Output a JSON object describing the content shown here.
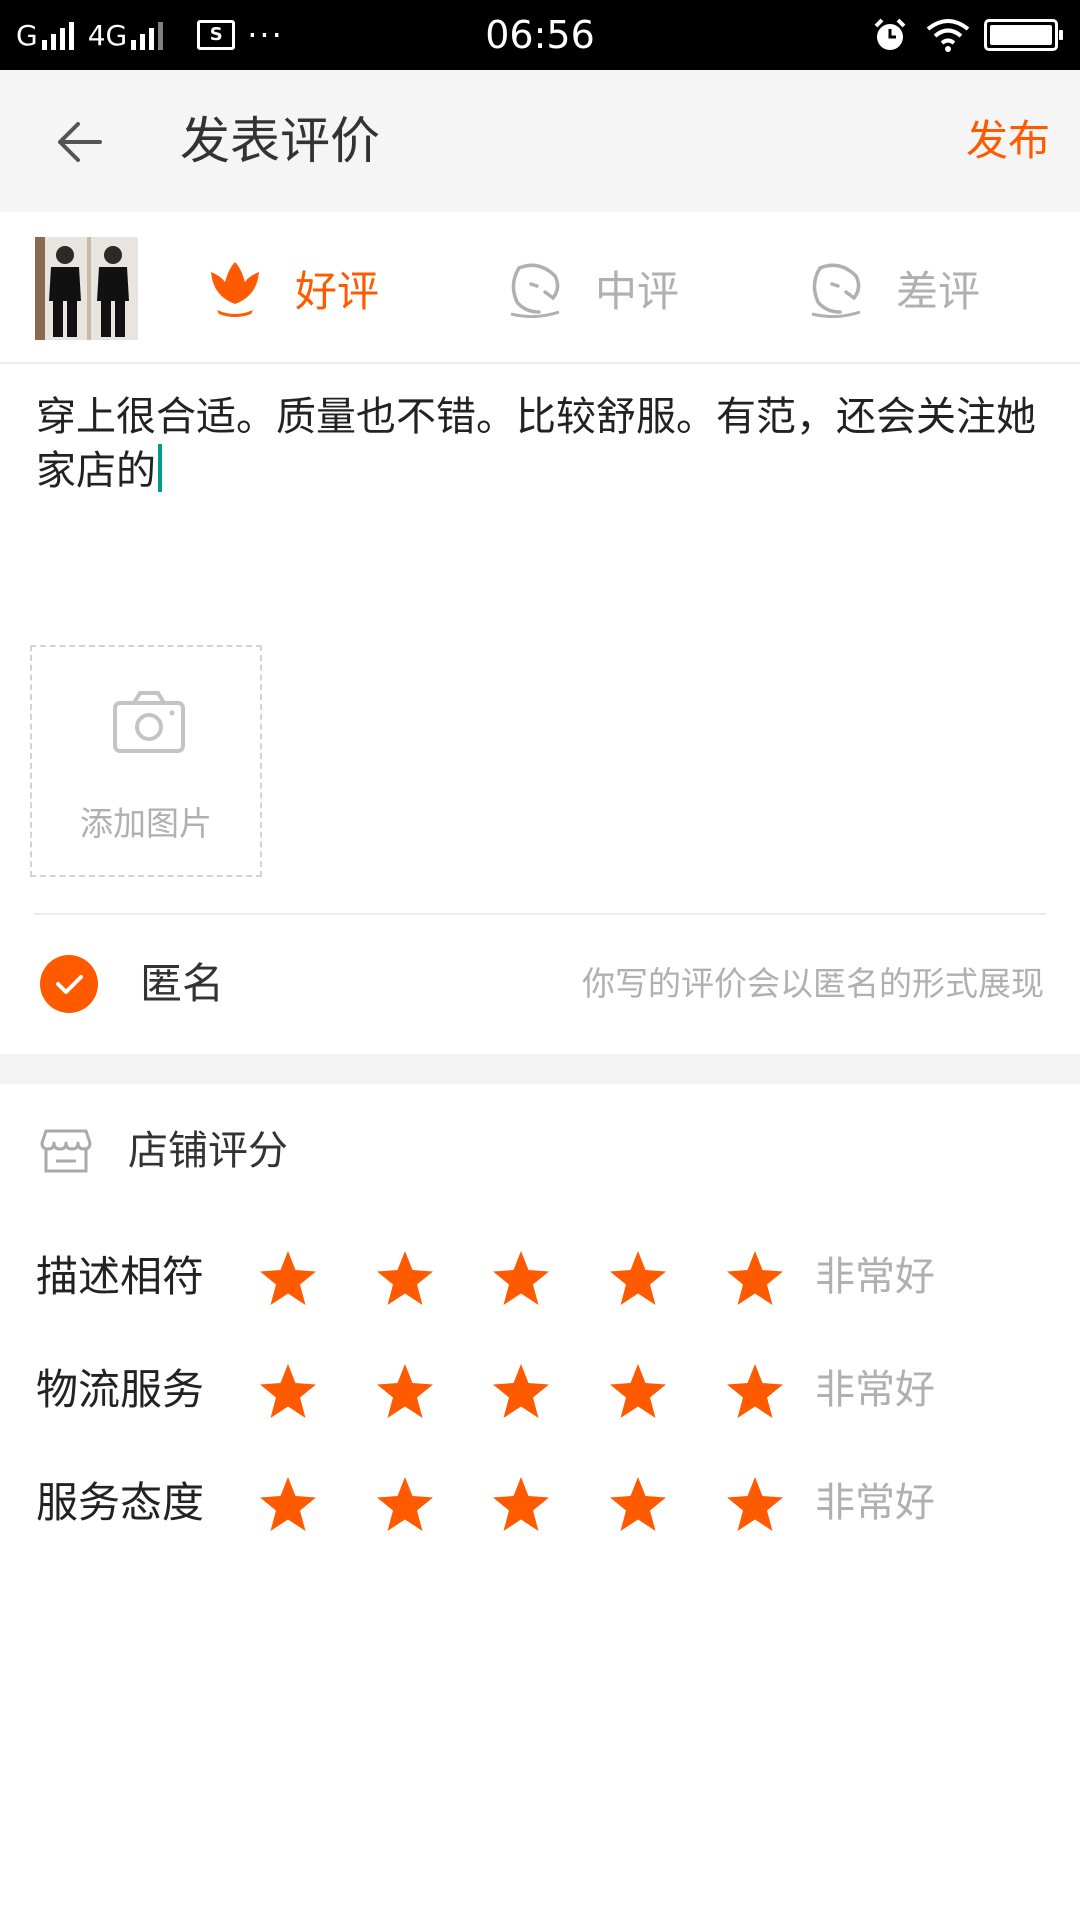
{
  "status_bar": {
    "carrier1": "G",
    "carrier2": "4G",
    "screenshot_badge": "S",
    "more": "···",
    "time": "06:56"
  },
  "header": {
    "title": "发表评价",
    "publish_label": "发布"
  },
  "rating_options": [
    {
      "label": "好评",
      "icon": "flower-icon",
      "selected": true
    },
    {
      "label": "中评",
      "icon": "face-neutral-icon",
      "selected": false
    },
    {
      "label": "差评",
      "icon": "face-sad-icon",
      "selected": false
    }
  ],
  "review": {
    "text": "穿上很合适。质量也不错。比较舒服。有范，还会关注她家店的"
  },
  "add_image": {
    "label": "添加图片"
  },
  "anonymous": {
    "checked": true,
    "label": "匿名",
    "hint": "你写的评价会以匿名的形式展现"
  },
  "shop_score": {
    "title": "店铺评分",
    "rows": [
      {
        "label": "描述相符",
        "stars": 5,
        "value_text": "非常好"
      },
      {
        "label": "物流服务",
        "stars": 5,
        "value_text": "非常好"
      },
      {
        "label": "服务态度",
        "stars": 5,
        "value_text": "非常好"
      }
    ]
  },
  "colors": {
    "accent": "#ff5a00",
    "muted": "#b0b0b0",
    "caret": "#009a8e"
  }
}
